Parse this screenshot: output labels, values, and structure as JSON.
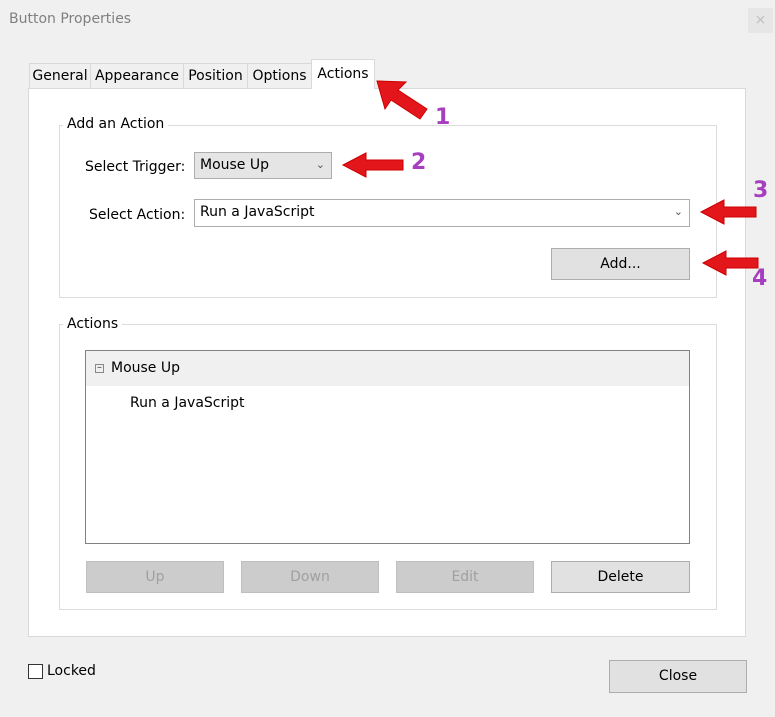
{
  "window": {
    "title": "Button Properties",
    "close_glyph": "×"
  },
  "tabs": [
    {
      "label": "General",
      "active": false
    },
    {
      "label": "Appearance",
      "active": false
    },
    {
      "label": "Position",
      "active": false
    },
    {
      "label": "Options",
      "active": false
    },
    {
      "label": "Actions",
      "active": true
    }
  ],
  "add_action": {
    "group_label": "Add an Action",
    "trigger_label": "Select Trigger:",
    "trigger_value": "Mouse Up",
    "action_label": "Select Action:",
    "action_value": "Run a JavaScript",
    "add_button": "Add..."
  },
  "actions": {
    "group_label": "Actions",
    "tree": [
      {
        "trigger": "Mouse Up",
        "children": [
          "Run a JavaScript"
        ]
      }
    ],
    "buttons": {
      "up": "Up",
      "down": "Down",
      "edit": "Edit",
      "delete": "Delete"
    }
  },
  "footer": {
    "locked_label": "Locked",
    "locked_checked": false,
    "close_button": "Close"
  },
  "annotations": {
    "color_arrow": "#e3161b",
    "color_number": "#a63fbf",
    "labels": [
      "1",
      "2",
      "3",
      "4"
    ]
  }
}
